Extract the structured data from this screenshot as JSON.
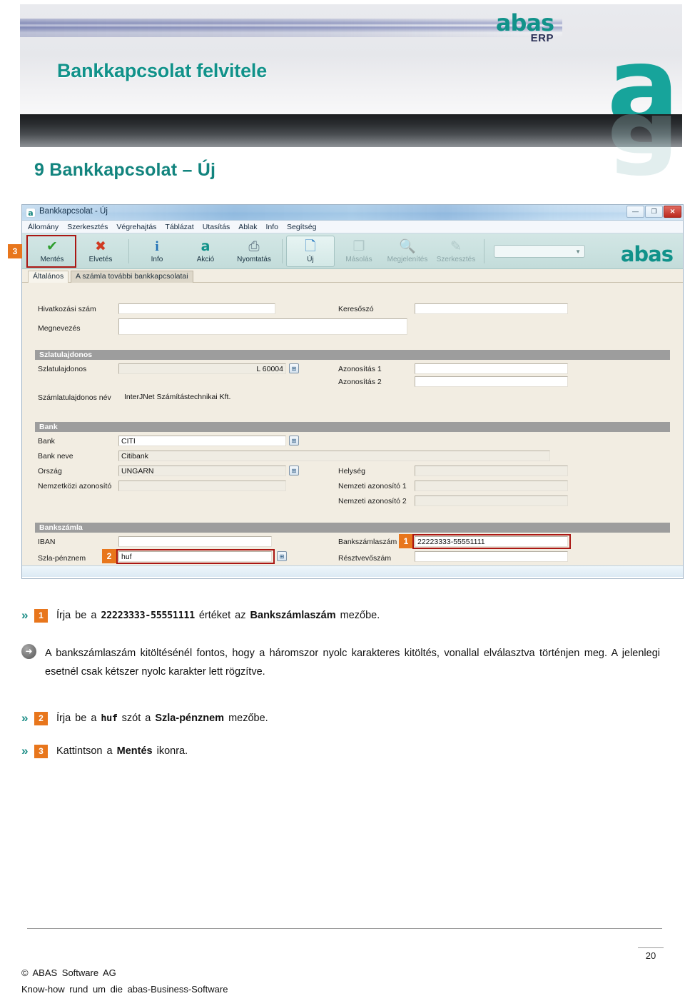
{
  "banner": {
    "title": "Bankkapcsolat felvitele",
    "logo_primary": "abas",
    "logo_secondary": "ERP",
    "logo_mark": "a"
  },
  "section": {
    "heading": "9 Bankkapcsolat – Új"
  },
  "erp_window": {
    "titlebar": {
      "title": "Bankkapcsolat - Új",
      "icon": "abas-app-icon",
      "minimize": "—",
      "maximize": "❐",
      "close": "✕"
    },
    "menu": [
      "Állomány",
      "Szerkesztés",
      "Végrehajtás",
      "Táblázat",
      "Utasítás",
      "Ablak",
      "Info",
      "Segítség"
    ],
    "toolbar": {
      "buttons": [
        {
          "label": "Mentés",
          "icon": "check-mark-icon",
          "glyph": "✔",
          "color": "#2f9e2f",
          "state": "enabled",
          "highlight": true
        },
        {
          "label": "Elvetés",
          "icon": "red-x-icon",
          "glyph": "✖",
          "color": "#d03a22",
          "state": "enabled",
          "highlight": false
        },
        {
          "label": "Info",
          "icon": "info-icon",
          "glyph": "i",
          "color": "#1f6fb5",
          "state": "enabled",
          "highlight": false
        },
        {
          "label": "Akció",
          "icon": "abas-a-icon",
          "glyph": "a",
          "color": "#11928a",
          "state": "enabled",
          "highlight": false
        },
        {
          "label": "Nyomtatás",
          "icon": "printer-icon",
          "glyph": "🖨",
          "color": "#6b7f8c",
          "state": "enabled",
          "highlight": false
        },
        {
          "label": "Új",
          "icon": "new-document-icon",
          "glyph": "🗋",
          "color": "#2f7fc4",
          "state": "enabled",
          "framed": true
        },
        {
          "label": "Másolás",
          "icon": "copy-icon",
          "glyph": "❐",
          "color": "#8aa5a7",
          "state": "disabled",
          "highlight": false
        },
        {
          "label": "Megjelenítés",
          "icon": "magnifier-icon",
          "glyph": "🔍",
          "color": "#8aa5a7",
          "state": "disabled",
          "highlight": false
        },
        {
          "label": "Szerkesztés",
          "icon": "pencil-edit-icon",
          "glyph": "✎",
          "color": "#8aa5a7",
          "state": "disabled",
          "highlight": false
        }
      ],
      "combo_value": "",
      "logo": "abas",
      "step_badge": "3"
    },
    "tabs": [
      {
        "label": "Általános",
        "active": true
      },
      {
        "label": "A számla további bankkapcsolatai",
        "active": false
      }
    ],
    "general_group": {
      "fields": [
        {
          "label": "Hivatkozási szám",
          "value": ""
        },
        {
          "label": "Megnevezés",
          "value": ""
        },
        {
          "label": "Keresőszó",
          "value": ""
        }
      ]
    },
    "owner_group": {
      "title": "Szlatulajdonos",
      "fields": [
        {
          "label": "Szlatulajdonos",
          "value": "L 60004"
        },
        {
          "label": "Számlatulajdonos név",
          "value": "InterJNet Számítástechnikai Kft."
        },
        {
          "label": "Azonosítás 1",
          "value": ""
        },
        {
          "label": "Azonosítás 2",
          "value": ""
        }
      ]
    },
    "bank_group": {
      "title": "Bank",
      "fields": [
        {
          "label": "Bank",
          "value": "CITI"
        },
        {
          "label": "Bank neve",
          "value": "Citibank"
        },
        {
          "label": "Ország",
          "value": "UNGARN"
        },
        {
          "label": "Nemzetközi azonosító",
          "value": ""
        },
        {
          "label": "Helység",
          "value": ""
        },
        {
          "label": "Nemzeti azonosító 1",
          "value": ""
        },
        {
          "label": "Nemzeti azonosító 2",
          "value": ""
        }
      ]
    },
    "account_group": {
      "title": "Bankszámla",
      "fields": [
        {
          "label": "IBAN",
          "value": ""
        },
        {
          "label": "Szla-pénznem",
          "value": "huf",
          "step_badge": "2",
          "highlight": true
        },
        {
          "label": "Bankszámlaszám",
          "value": "22223333-55551111",
          "step_badge": "1",
          "highlight": true
        },
        {
          "label": "Résztvevőszám",
          "value": ""
        }
      ]
    }
  },
  "instructions": [
    {
      "badge": "1",
      "parts": [
        {
          "t": "Írja be a ",
          "style": "normal"
        },
        {
          "t": "22223333-55551111",
          "style": "mono"
        },
        {
          "t": " értéket az ",
          "style": "normal"
        },
        {
          "t": "Bankszámlaszám",
          "style": "bold"
        },
        {
          "t": " mezőbe.",
          "style": "normal"
        }
      ]
    },
    {
      "badge": "2",
      "parts": [
        {
          "t": "Írja be a ",
          "style": "normal"
        },
        {
          "t": "huf",
          "style": "mono"
        },
        {
          "t": " szót a ",
          "style": "normal"
        },
        {
          "t": "Szla-pénznem",
          "style": "bold"
        },
        {
          "t": " mezőbe.",
          "style": "normal"
        }
      ]
    },
    {
      "badge": "3",
      "parts": [
        {
          "t": "Kattintson a ",
          "style": "normal"
        },
        {
          "t": "Mentés",
          "style": "bold"
        },
        {
          "t": " ikonra.",
          "style": "normal"
        }
      ]
    }
  ],
  "note": {
    "icon": "arrow-right-circle-icon",
    "text": "A bankszámlaszám kitöltésénél fontos, hogy a háromszor nyolc karakteres kitöltés, vonallal elválasztva történjen meg. A jelenlegi esetnél csak kétszer nyolc karakter lett rögzítve."
  },
  "footer": {
    "page_number": "20",
    "line1": "© ABAS Software AG",
    "line2": "Know-how rund um die abas-Business-Software"
  },
  "colors": {
    "brand_teal": "#11928a",
    "accent_orange": "#e8761c",
    "highlight_red": "#aa1713",
    "form_bg": "#f2ede2",
    "group_header": "#9d9d9d"
  }
}
